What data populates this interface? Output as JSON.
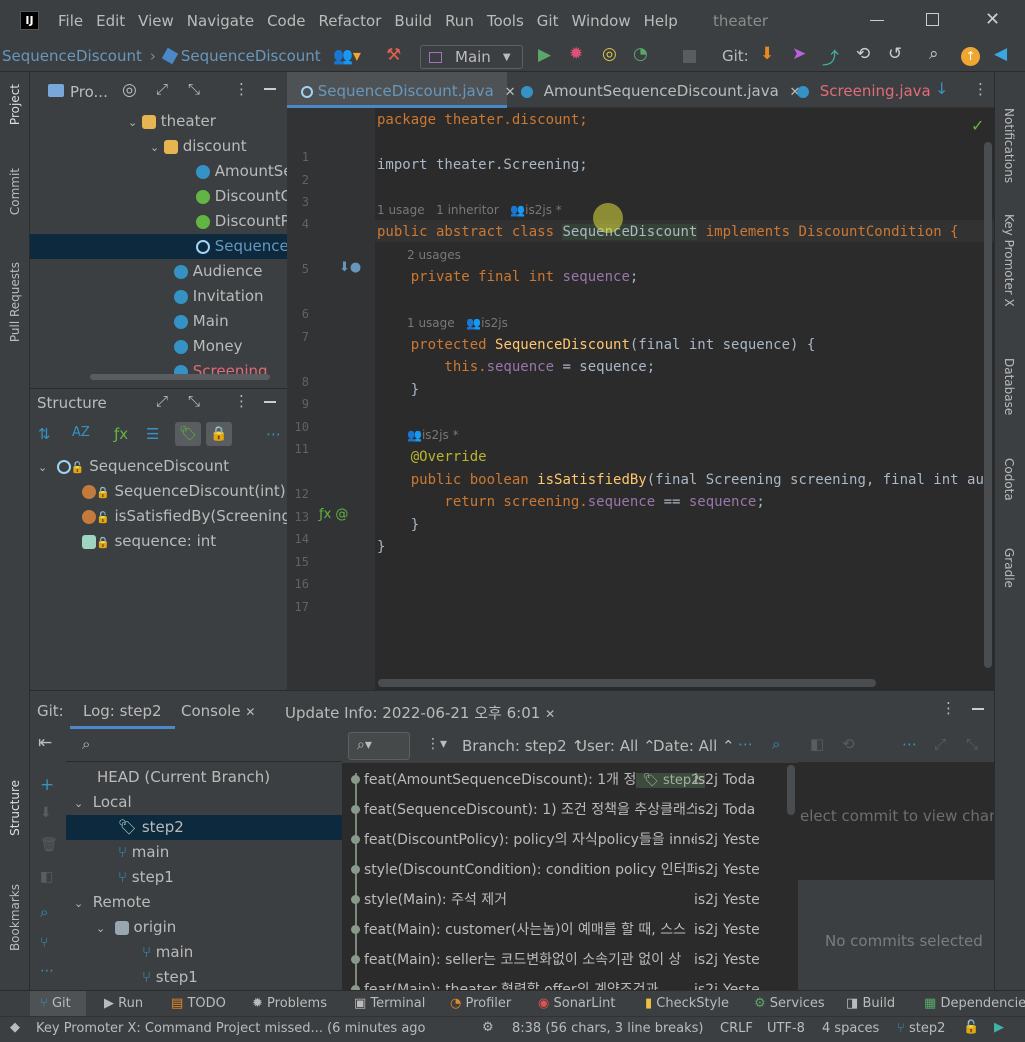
{
  "menu": [
    "File",
    "Edit",
    "View",
    "Navigate",
    "Code",
    "Refactor",
    "Build",
    "Run",
    "Tools",
    "Git",
    "Window",
    "Help"
  ],
  "window_title": "theater",
  "breadcrumb": [
    "SequenceDiscount",
    "SequenceDiscount"
  ],
  "run_config": "Main",
  "git_label": "Git:",
  "left_strip": [
    "Project",
    "Commit",
    "Pull Requests",
    "Structure",
    "Bookmarks"
  ],
  "right_strip": [
    "Notifications",
    "Key Promoter X",
    "Database",
    "Codota",
    "Gradle"
  ],
  "project": {
    "header": "Pro...",
    "tree": [
      {
        "label": "theater",
        "type": "folder"
      },
      {
        "label": "discount",
        "type": "folder"
      },
      {
        "label": "AmountSe",
        "type": "class"
      },
      {
        "label": "DiscountC",
        "type": "interface"
      },
      {
        "label": "DiscountP",
        "type": "interface"
      },
      {
        "label": "SequenceI",
        "type": "abstract"
      },
      {
        "label": "Audience",
        "type": "class"
      },
      {
        "label": "Invitation",
        "type": "class"
      },
      {
        "label": "Main",
        "type": "main"
      },
      {
        "label": "Money",
        "type": "class"
      },
      {
        "label": "Screening",
        "type": "class"
      }
    ]
  },
  "structure": {
    "title": "Structure",
    "items": [
      {
        "label": "SequenceDiscount"
      },
      {
        "label": "SequenceDiscount(int)"
      },
      {
        "label": "isSatisfiedBy(Screening,"
      },
      {
        "label": "sequence: int"
      }
    ]
  },
  "editor": {
    "tabs": [
      {
        "label": "SequenceDiscount.java",
        "active": true
      },
      {
        "label": "AmountSequenceDiscount.java",
        "active": false
      },
      {
        "label": "Screening.java",
        "active": false
      }
    ],
    "hints": {
      "class_usage": "1 usage",
      "class_inheritor": "1 inheritor",
      "class_author": "is2js *",
      "field_usage": "2 usages",
      "ctor_usage": "1 usage",
      "ctor_author": "is2js",
      "method_author": "is2js *"
    },
    "lines": {
      "l1": "package theater.discount;",
      "l3": "import theater.Screening;",
      "l5a": "public abstract class ",
      "l5b": "SequenceDiscount",
      "l5c": " implements DiscountCondition {",
      "l6a": "    private final int ",
      "l6b": "sequence",
      "l6c": ";",
      "l8a": "    protected ",
      "l8b": "SequenceDiscount",
      "l8c": "(final int sequence) {",
      "l9a": "        this.",
      "l9b": "sequence",
      "l9c": " = sequence;",
      "l10": "    }",
      "l12": "    @Override",
      "l13a": "    public boolean ",
      "l13b": "isSatisfiedBy",
      "l13c": "(final Screening screening, final int audienc",
      "l14a": "        return screening.",
      "l14b": "sequence",
      "l14c": " == ",
      "l14d": "sequence",
      "l14e": ";",
      "l15": "    }",
      "l16": "}"
    }
  },
  "bottom": {
    "tabs": [
      "Git:",
      "Log: step2",
      "Console",
      "Update Info: 2022-06-21 오후 6:01"
    ],
    "filter_branch": "Branch: step2",
    "filter_user": "User: All",
    "filter_date": "Date: All",
    "branches": {
      "head": "HEAD (Current Branch)",
      "local": "Local",
      "local_items": [
        "step2",
        "main",
        "step1"
      ],
      "remote": "Remote",
      "origin": "origin",
      "origin_items": [
        "main",
        "step1"
      ]
    },
    "commits": [
      {
        "msg": "feat(AmountSequenceDiscount): 1개 정",
        "tag": "step2",
        "author": "is2j",
        "date": "Toda"
      },
      {
        "msg": "feat(SequenceDiscount): 1) 조건 정책을 추상클래스",
        "author": "is2j",
        "date": "Toda"
      },
      {
        "msg": "feat(DiscountPolicy): policy의 자식policy들을 inne",
        "author": "is2j",
        "date": "Yeste"
      },
      {
        "msg": "style(DiscountCondition): condition policy 인터페",
        "author": "is2j",
        "date": "Yeste"
      },
      {
        "msg": "style(Main): 주석 제거",
        "author": "is2j",
        "date": "Yeste"
      },
      {
        "msg": "feat(Main): customer(사는놈)이 예매를 할 때, 스스",
        "author": "is2j",
        "date": "Yeste"
      },
      {
        "msg": "feat(Main): seller는 코드변화없이 소속기관 없이 상",
        "author": "is2j",
        "date": "Yeste"
      },
      {
        "msg": "feat(Main): theater 협력할 offer의 계약조건과",
        "author": "is2j",
        "date": "Yeste"
      }
    ],
    "details_msg": "elect commit to view change",
    "no_commits": "No commits selected"
  },
  "toolwindows": [
    "Git",
    "Run",
    "TODO",
    "Problems",
    "Terminal",
    "Profiler",
    "SonarLint",
    "CheckStyle",
    "Services",
    "Build",
    "Dependencie"
  ],
  "status": {
    "message": "Key Promoter X: Command Project missed... (6 minutes ago",
    "position": "8:38 (56 chars, 3 line breaks)",
    "line_sep": "CRLF",
    "encoding": "UTF-8",
    "indent": "4 spaces",
    "branch": "step2"
  },
  "colors": {
    "accent": "#4a88c7",
    "selection": "#0d293e",
    "keyword": "#cc7832",
    "field": "#9876aa",
    "method": "#ffc66d",
    "annotation": "#bbb529",
    "vcs_changed": "#6897bb",
    "error_file": "#e06c75"
  }
}
